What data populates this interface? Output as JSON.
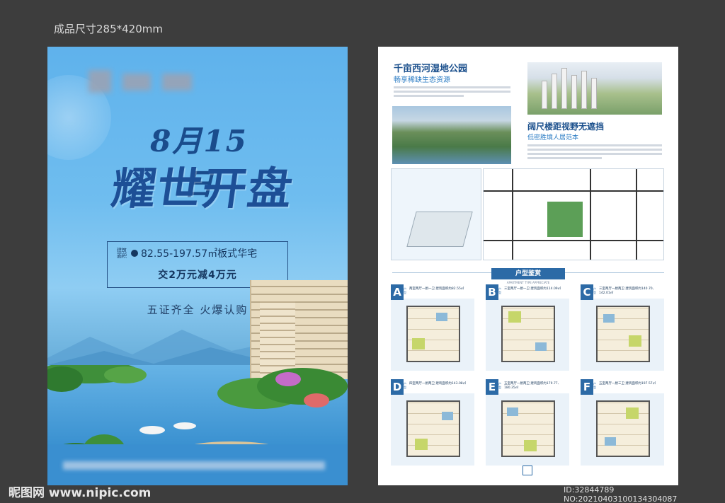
{
  "size_label": "成品尺寸285*420mm",
  "poster": {
    "date": "8月15日",
    "title": "耀世开盘",
    "area_tag": "建筑面积",
    "area_text": "82.55-197.57㎡板式华宅",
    "offer": "交2万元减4万元",
    "slogan": "五证齐全 火爆认购"
  },
  "sheet": {
    "section1_title": "千亩西河湿地公园",
    "section1_sub": "畅享稀缺生态资源",
    "section2_title": "阔尺楼距视野无遮挡",
    "section2_sub": "低密胜境人居范本",
    "units_head": "户型鉴赏",
    "units_head_sub": "APARTMENT TYPE APPRECIATE",
    "units": [
      {
        "letter": "A",
        "tag": "户型",
        "desc": "两室两厅一厨一卫 建筑面积约82.55㎡"
      },
      {
        "letter": "B",
        "tag": "户型",
        "desc": "三室两厅一厨一卫 建筑面积约114.09㎡"
      },
      {
        "letter": "C",
        "tag": "户型",
        "desc": "三室两厅一厨两卫 建筑面积约140.70、142.01㎡"
      },
      {
        "letter": "D",
        "tag": "户型",
        "desc": "四室两厅一厨两卫 建筑面积约143.08㎡"
      },
      {
        "letter": "E",
        "tag": "户型",
        "desc": "五室两厅一厨两卫 建筑面积约179.77、180.35㎡"
      },
      {
        "letter": "F",
        "tag": "户型",
        "desc": "五室两厅一厨三卫 建筑面积约197.57㎡"
      }
    ]
  },
  "watermark": "昵图网 www.nipic.com",
  "id_tag": "ID:32844789 NO:20210403100134304087",
  "colors": {
    "brand_blue": "#1a4f8c",
    "accent_blue": "#2c6aa6",
    "sky": "#6fbdef"
  }
}
